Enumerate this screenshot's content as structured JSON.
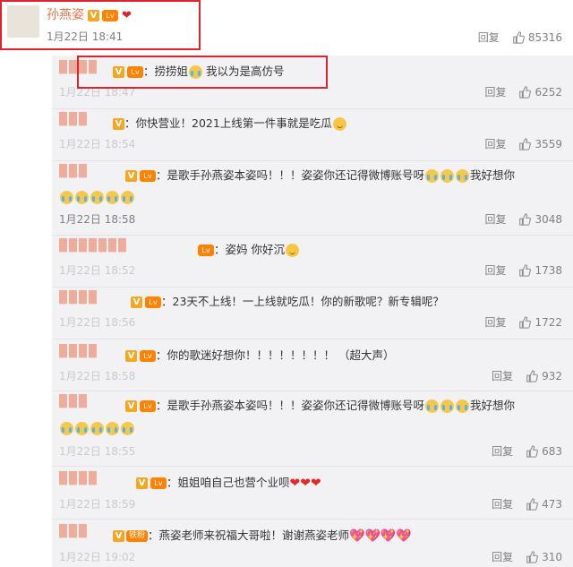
{
  "main": {
    "author": "孙燕姿",
    "verified": "V",
    "level": "Lv",
    "time": "1月22日 18:41",
    "reply_label": "回复",
    "likes": "85316"
  },
  "replies": [
    {
      "user": "",
      "text": "：捞捞姐",
      "text2": "我以为是高仿号",
      "time": "1月22日 18:47",
      "likes": "6252"
    },
    {
      "user": "",
      "text": "：你快营业！2021上线第一件事就是吃瓜",
      "time": "1月22日 18:54",
      "likes": "3559"
    },
    {
      "user": "",
      "text": "：是歌手孙燕姿本姿吗！！！姿姿你还记得微博账号呀",
      "text2": "我好想你",
      "time": "1月22日 18:58",
      "likes": "3048"
    },
    {
      "user": "",
      "text": "：姿妈 你好沉",
      "time": "1月22日 18:52",
      "likes": "1738"
    },
    {
      "user": "",
      "text": "：23天不上线！一上线就吃瓜！你的新歌呢？新专辑呢？",
      "time": "1月22日 18:56",
      "likes": "1722"
    },
    {
      "user": "",
      "text": "：你的歌迷好想你！！！！！！！！ （超大声）",
      "time": "1月22日 18:58",
      "likes": "932"
    },
    {
      "user": "",
      "text": "：是歌手孙燕姿本姿吗！！！姿姿你还记得微博账号呀",
      "text2": "我好想你",
      "time": "1月22日 18:55",
      "likes": "683"
    },
    {
      "user": "",
      "text": "：姐姐咱自己也营个业呗",
      "time": "1月22日 18:59",
      "likes": "473"
    },
    {
      "user": "",
      "text": "：燕姿老师来祝福大哥啦！谢谢燕姿老师",
      "fan": "铁粉",
      "time": "1月22日 19:02",
      "likes": "310"
    }
  ],
  "colors": {
    "accent": "#eb7350",
    "highlight_box": "#e0212e",
    "sub_bg": "#f2f2f5"
  }
}
